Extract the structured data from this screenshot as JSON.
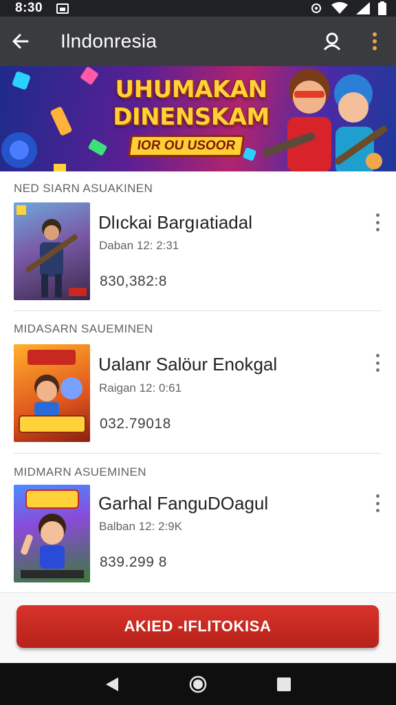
{
  "status_bar": {
    "time": "8:30"
  },
  "app_bar": {
    "title": "Ilndonresia",
    "icons": [
      "back-arrow-icon",
      "account-icon",
      "more-vert-icon"
    ]
  },
  "banner": {
    "title_line1": "UHUMAKAN",
    "title_line2": "DINENSKAM",
    "subtitle": "IOR OU USOOR"
  },
  "sections": [
    {
      "label": "NED SIARN ASUAKINEN",
      "title": "Dlıckai Bargıatiadal",
      "date": "Daban 12: 2:31",
      "count": "830,382:8"
    },
    {
      "label": "MIDASARN SAUEMINEN",
      "title": "Ualanr Salöur Enokgal",
      "date": "Raigan 12: 0:61",
      "count": "032.79018"
    },
    {
      "label": "MIDMARN ASUEMINEN",
      "title": "Garhal FanguDOagul",
      "date": "Balban 12: 2:9K",
      "count": "839.299 8"
    }
  ],
  "cta": {
    "label": "AKIED -IFLITOKISA"
  },
  "colors": {
    "status_bar": "#202124",
    "app_bar": "#3a3b3e",
    "cta": "#c8281f",
    "nav_bar": "#0f0f0f"
  }
}
